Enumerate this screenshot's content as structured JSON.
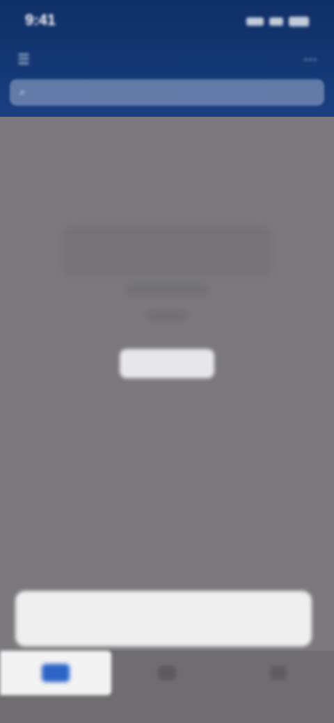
{
  "status_bar": {
    "time": "9:41",
    "icons": [
      "signal-icon",
      "wifi-icon",
      "battery-icon"
    ]
  },
  "header": {
    "title": "",
    "left_icon": "menu-icon",
    "right_icon": "more-icon"
  },
  "search": {
    "placeholder": "",
    "icon": "search-icon"
  },
  "empty_state": {
    "title": "",
    "subtitle": "",
    "subtitle2": "",
    "button_label": ""
  },
  "bottom_card": {
    "text": ""
  },
  "tabs": [
    {
      "label": "",
      "icon": "home-icon",
      "active": true
    },
    {
      "label": "",
      "icon": "list-icon",
      "active": false
    },
    {
      "label": "",
      "icon": "profile-icon",
      "active": false
    }
  ],
  "colors": {
    "header": "#153a78",
    "overlay": "#7b797b",
    "active_tab_icon": "#2c63c6",
    "card": "#efeff0"
  }
}
